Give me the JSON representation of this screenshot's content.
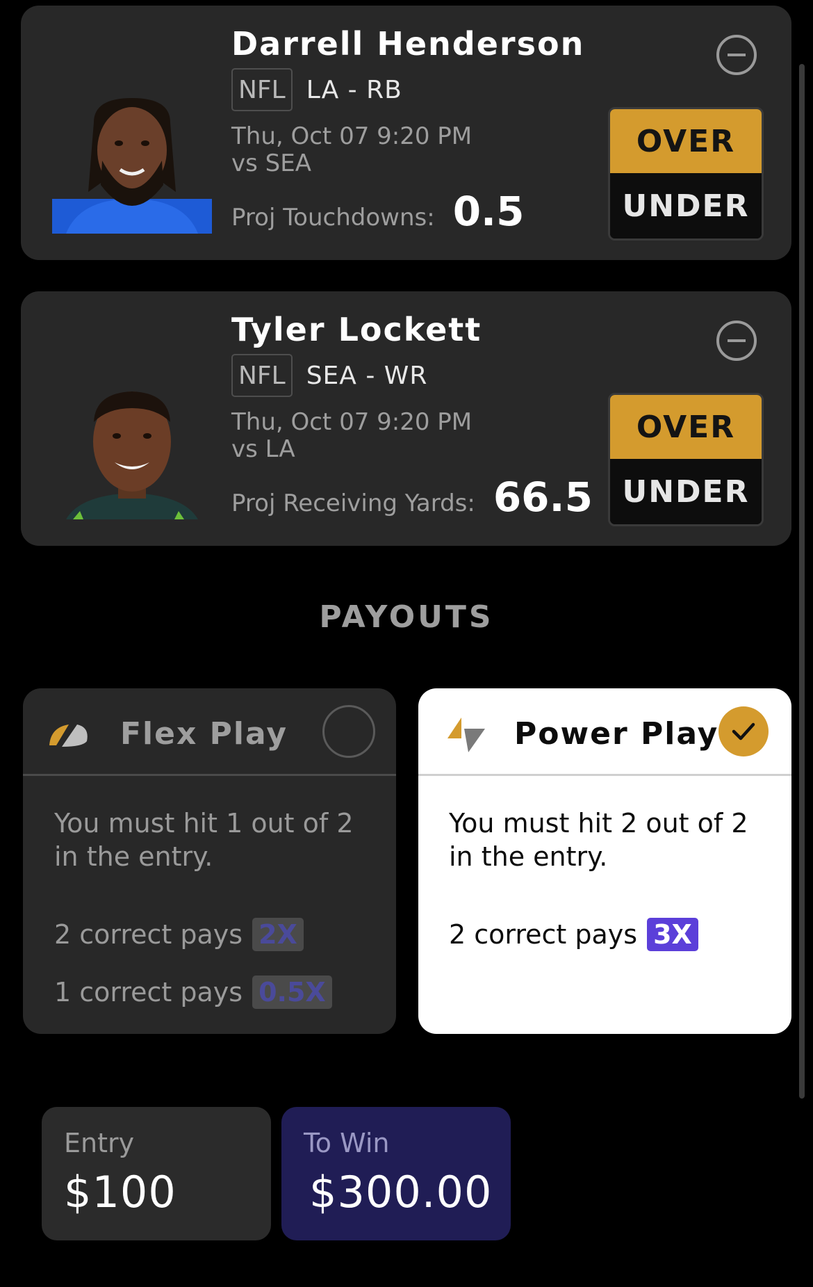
{
  "players": [
    {
      "name": "Darrell Henderson",
      "league": "NFL",
      "team_pos": "LA - RB",
      "game_time": "Thu, Oct 07 9:20 PM",
      "opponent": "vs SEA",
      "proj_label": "Proj Touchdowns:",
      "proj_value": "0.5",
      "over_label": "OVER",
      "under_label": "UNDER",
      "selected": "over"
    },
    {
      "name": "Tyler Lockett",
      "league": "NFL",
      "team_pos": "SEA - WR",
      "game_time": "Thu, Oct 07 9:20 PM",
      "opponent": "vs LA",
      "proj_label": "Proj Receiving Yards:",
      "proj_value": "66.5",
      "over_label": "OVER",
      "under_label": "UNDER",
      "selected": "over"
    }
  ],
  "payouts": {
    "title": "PAYOUTS",
    "flex": {
      "title": "Flex Play",
      "description": "You must hit 1 out of 2 in the entry.",
      "lines": [
        {
          "text": "2 correct pays",
          "mult": "2X"
        },
        {
          "text": "1 correct pays",
          "mult": "0.5X"
        }
      ],
      "selected": false
    },
    "power": {
      "title": "Power Play",
      "description": "You must hit 2 out of 2 in the entry.",
      "lines": [
        {
          "text": "2 correct pays",
          "mult": "3X"
        }
      ],
      "selected": true
    }
  },
  "entry": {
    "label": "Entry",
    "value": "$100"
  },
  "to_win": {
    "label": "To Win",
    "value": "$300.00"
  },
  "colors": {
    "accent_gold": "#d49b2e",
    "purple": "#5b3fd9",
    "to_win_bg": "#201d55",
    "card_bg": "#282828"
  }
}
